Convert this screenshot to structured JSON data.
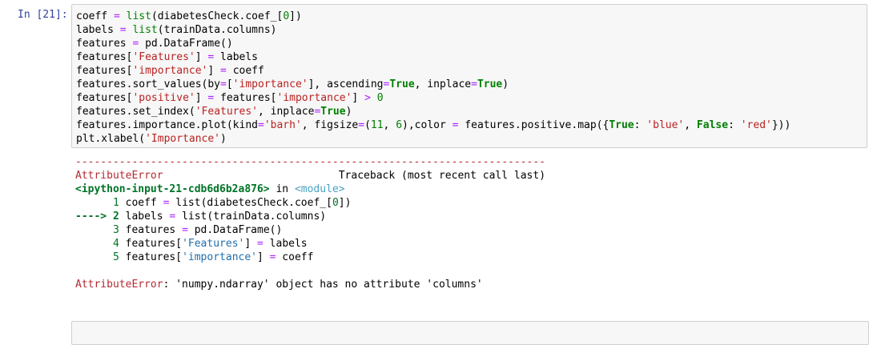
{
  "cell": {
    "prompt": "In [21]:",
    "code": {
      "l1a": "coeff",
      "l1b": "list",
      "l1c": "(diabetesCheck.coef_[",
      "l1d": "0",
      "l1e": "])",
      "l2a": "labels",
      "l2b": "list",
      "l2c": "(trainData.columns)",
      "l3a": "features",
      "l3b": "pd.DataFrame()",
      "l4a": "features[",
      "l4b": "'Features'",
      "l4c": "]",
      "l4d": "labels",
      "l5a": "features[",
      "l5b": "'importance'",
      "l5c": "]",
      "l5d": "coeff",
      "l6a": "features.sort_values(by",
      "l6b": "[",
      "l6c": "'importance'",
      "l6d": "], ascending",
      "l6e": "True",
      "l6f": ", inplace",
      "l6g": "True",
      "l6h": ")",
      "l7a": "features[",
      "l7b": "'positive'",
      "l7c": "]",
      "l7d": "features[",
      "l7e": "'importance'",
      "l7f": "]",
      "l7g": "0",
      "l8a": "features.set_index(",
      "l8b": "'Features'",
      "l8c": ", inplace",
      "l8d": "True",
      "l8e": ")",
      "l9a": "features.importance.plot(kind",
      "l9b": "'barh'",
      "l9c": ", figsize",
      "l9d": "(",
      "l9e": "11",
      "l9f": ", ",
      "l9g": "6",
      "l9h": "),color ",
      "l9i": " features.positive.map({",
      "l9j": "True",
      "l9k": ": ",
      "l9l": "'blue'",
      "l9m": ", ",
      "l9n": "False",
      "l9o": ": ",
      "l9p": "'red'",
      "l9q": "}))",
      "l10a": "plt.xlabel(",
      "l10b": "'Importance'",
      "l10c": ")"
    }
  },
  "output": {
    "dashes": "---------------------------------------------------------------------------",
    "error_name": "AttributeError",
    "traceback_label": "Traceback (most recent call last)",
    "input_ref": "<ipython-input-21-cdb6d6b2a876>",
    "in_word": " in ",
    "module": "<module>",
    "t1_num": "      1 ",
    "t1_a": "coeff ",
    "t1_b": "list",
    "t1_c": "(diabetesCheck",
    "t1_d": ".",
    "t1_e": "coef_",
    "t1_f": "[",
    "t1_g": "0",
    "t1_h": "])",
    "t2_arrow": "----> 2 ",
    "t2_a": "labels ",
    "t2_b": "list",
    "t2_c": "(trainData",
    "t2_d": ".",
    "t2_e": "columns)",
    "t3_num": "      3 ",
    "t3_a": "features ",
    "t3_b": "pd",
    "t3_c": ".",
    "t3_d": "DataFrame()",
    "t4_num": "      4 ",
    "t4_a": "features[",
    "t4_b": "'Features'",
    "t4_c": "] ",
    "t4_d": " labels",
    "t5_num": "      5 ",
    "t5_a": "features[",
    "t5_b": "'importance'",
    "t5_c": "] ",
    "t5_d": " coeff",
    "final_name": "AttributeError",
    "final_msg": ": 'numpy.ndarray' object has no attribute 'columns'"
  }
}
